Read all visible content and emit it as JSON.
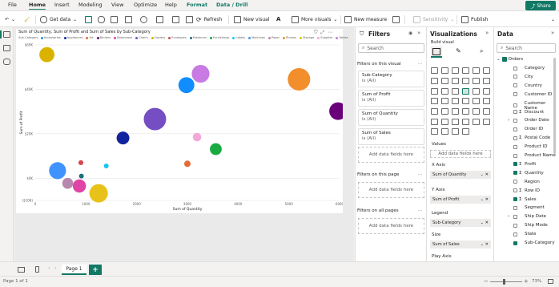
{
  "menubar": {
    "items": [
      "File",
      "Home",
      "Insert",
      "Modeling",
      "View",
      "Optimize",
      "Help",
      "Format",
      "Data / Drill"
    ],
    "active": "Home",
    "share_label": "Share"
  },
  "ribbon": {
    "get_data": "Get data",
    "refresh": "Refresh",
    "new_visual": "New visual",
    "more_visuals": "More visuals",
    "new_measure": "New measure",
    "sensitivity": "Sensitivity",
    "publish": "Publish"
  },
  "visual": {
    "title": "Sum of Quantity, Sum of Profit and Sum of Sales by Sub-Category",
    "legend_title": "Sub-Category"
  },
  "chart_data": {
    "type": "scatter",
    "title": "Sum of Quantity, Sum of Profit and Sum of Sales by Sub-Category",
    "xlabel": "Sum of Quantity",
    "ylabel": "Sum of Profit",
    "xlim": [
      0,
      6000
    ],
    "ylim": [
      -10000,
      60000
    ],
    "x_ticks": [
      "0",
      "1000",
      "2000",
      "3000",
      "4000",
      "5000",
      "6000"
    ],
    "y_ticks": [
      "($10K)",
      "$0K",
      "$20K",
      "$40K",
      "$60K"
    ],
    "y_tick_values": [
      -10000,
      0,
      20000,
      40000,
      60000
    ],
    "legend_title": "Sub-Category",
    "series": [
      {
        "name": "Accessories",
        "color": "#118DFF",
        "x": 2980,
        "y": 41900,
        "size": 167000
      },
      {
        "name": "Appliances",
        "color": "#12239E",
        "x": 1730,
        "y": 18100,
        "size": 107000
      },
      {
        "name": "Art",
        "color": "#E66C37",
        "x": 3000,
        "y": 6500,
        "size": 27000
      },
      {
        "name": "Binders",
        "color": "#6B007B",
        "x": 5970,
        "y": 30200,
        "size": 203000
      },
      {
        "name": "Bookcases",
        "color": "#E044A7",
        "x": 870,
        "y": -3500,
        "size": 115000
      },
      {
        "name": "Chairs",
        "color": "#744EC2",
        "x": 2360,
        "y": 26600,
        "size": 328000
      },
      {
        "name": "Copiers",
        "color": "#D9B300",
        "x": 230,
        "y": 55600,
        "size": 150000
      },
      {
        "name": "Envelopes",
        "color": "#D64550",
        "x": 900,
        "y": 7000,
        "size": 16000
      },
      {
        "name": "Fasteners",
        "color": "#197278",
        "x": 910,
        "y": 950,
        "size": 3000
      },
      {
        "name": "Furnishings",
        "color": "#1AAB40",
        "x": 3560,
        "y": 13100,
        "size": 92000
      },
      {
        "name": "Labels",
        "color": "#15C6F4",
        "x": 1400,
        "y": 5500,
        "size": 12000
      },
      {
        "name": "Machines",
        "color": "#4092FF",
        "x": 440,
        "y": 3400,
        "size": 189000
      },
      {
        "name": "Paper",
        "color": "#B887AD",
        "x": 640,
        "y": -2300,
        "size": 78000
      },
      {
        "name": "Phones",
        "color": "#F28E2B",
        "x": 5200,
        "y": 44500,
        "size": 330000
      },
      {
        "name": "Storage",
        "color": "#E8C21B",
        "x": 1250,
        "y": -6800,
        "size": 224000
      },
      {
        "name": "Supplies",
        "color": "#F3A8D8",
        "x": 3190,
        "y": 18500,
        "size": 47000
      },
      {
        "name": "Tables",
        "color": "#C77BE3",
        "x": 3260,
        "y": 47000,
        "size": 207000
      }
    ]
  },
  "filters": {
    "title": "Filters",
    "search_placeholder": "Search",
    "on_visual": "Filters on this visual",
    "cards": [
      {
        "name": "Sub-Category",
        "value": "is (All)"
      },
      {
        "name": "Sum of Profit",
        "value": "is (All)"
      },
      {
        "name": "Sum of Quantity",
        "value": "is (All)"
      },
      {
        "name": "Sum of Sales",
        "value": "is (All)"
      }
    ],
    "add_fields": "Add data fields here",
    "on_page": "Filters on this page",
    "on_all_pages": "Filters on all pages"
  },
  "visualizations": {
    "title": "Visualizations",
    "build_visual": "Build visual",
    "wells": [
      {
        "label": "Values",
        "field": ""
      },
      {
        "label": "X Axis",
        "field": "Sum of Quantity"
      },
      {
        "label": "Y Axis",
        "field": "Sum of Profit"
      },
      {
        "label": "Legend",
        "field": "Sub-Category"
      },
      {
        "label": "Size",
        "field": "Sum of Sales"
      },
      {
        "label": "Play Axis",
        "field": ""
      }
    ],
    "add_fields": "Add data fields here"
  },
  "data_pane": {
    "title": "Data",
    "search_placeholder": "Search",
    "table": "Orders",
    "fields": [
      {
        "name": "Category",
        "checked": false,
        "sigma": false,
        "expand": false
      },
      {
        "name": "City",
        "checked": false,
        "sigma": false,
        "expand": false
      },
      {
        "name": "Country",
        "checked": false,
        "sigma": false,
        "expand": false
      },
      {
        "name": "Customer ID",
        "checked": false,
        "sigma": false,
        "expand": false
      },
      {
        "name": "Customer Name",
        "checked": false,
        "sigma": false,
        "expand": false
      },
      {
        "name": "Discount",
        "checked": false,
        "sigma": true,
        "expand": false
      },
      {
        "name": "Order Date",
        "checked": false,
        "sigma": false,
        "expand": true
      },
      {
        "name": "Order ID",
        "checked": false,
        "sigma": false,
        "expand": false
      },
      {
        "name": "Postal Code",
        "checked": false,
        "sigma": true,
        "expand": false
      },
      {
        "name": "Product ID",
        "checked": false,
        "sigma": false,
        "expand": false
      },
      {
        "name": "Product Name",
        "checked": false,
        "sigma": false,
        "expand": false
      },
      {
        "name": "Profit",
        "checked": true,
        "sigma": true,
        "expand": false
      },
      {
        "name": "Quantity",
        "checked": true,
        "sigma": true,
        "expand": false
      },
      {
        "name": "Region",
        "checked": false,
        "sigma": false,
        "expand": false
      },
      {
        "name": "Row ID",
        "checked": false,
        "sigma": true,
        "expand": false
      },
      {
        "name": "Sales",
        "checked": true,
        "sigma": true,
        "expand": false
      },
      {
        "name": "Segment",
        "checked": false,
        "sigma": false,
        "expand": false
      },
      {
        "name": "Ship Date",
        "checked": false,
        "sigma": false,
        "expand": true
      },
      {
        "name": "Ship Mode",
        "checked": false,
        "sigma": false,
        "expand": false
      },
      {
        "name": "State",
        "checked": false,
        "sigma": false,
        "expand": false
      },
      {
        "name": "Sub-Category",
        "checked": true,
        "sigma": false,
        "expand": false
      }
    ]
  },
  "tabs": {
    "page1": "Page 1",
    "add": "+"
  },
  "status": {
    "page": "Page 1 of 1",
    "zoom": "73%"
  }
}
